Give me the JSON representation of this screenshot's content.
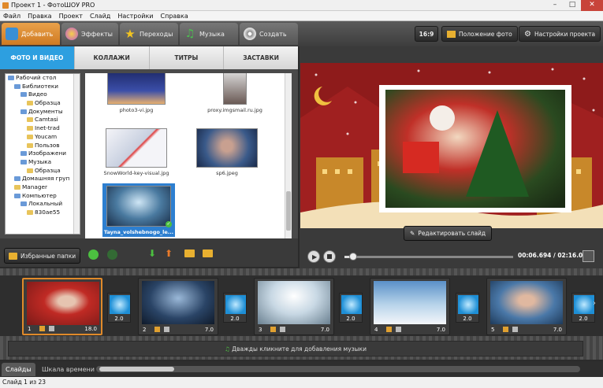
{
  "window": {
    "title": "Проект 1 - ФотоШОУ PRO"
  },
  "menu": [
    "Файл",
    "Правка",
    "Проект",
    "Слайд",
    "Настройки",
    "Справка"
  ],
  "tabs": [
    {
      "label": "Добавить",
      "color": "#3a8fd6"
    },
    {
      "label": "Эффекты",
      "color": "#c05ad0"
    },
    {
      "label": "Переходы",
      "color": "#e8c020"
    },
    {
      "label": "Музыка",
      "color": "#48b050"
    },
    {
      "label": "Создать",
      "color": "#d8d8d8"
    }
  ],
  "toolbar_right": {
    "ratio": "16:9",
    "photo_pos": "Положение фото",
    "project_settings": "Настройки проекта"
  },
  "subtabs": [
    "ФОТО И ВИДЕО",
    "КОЛЛАЖИ",
    "ТИТРЫ",
    "ЗАСТАВКИ"
  ],
  "tree": [
    {
      "label": "Рабочий стол",
      "indent": 0,
      "icon": "blue"
    },
    {
      "label": "Библиотеки",
      "indent": 1,
      "icon": "blue"
    },
    {
      "label": "Видео",
      "indent": 2,
      "icon": "blue"
    },
    {
      "label": "Образца",
      "indent": 3,
      "icon": "yellow"
    },
    {
      "label": "Документы",
      "indent": 2,
      "icon": "blue"
    },
    {
      "label": "Camtasi",
      "indent": 3,
      "icon": "yellow"
    },
    {
      "label": "Inet-trad",
      "indent": 3,
      "icon": "yellow"
    },
    {
      "label": "Youcam",
      "indent": 3,
      "icon": "yellow"
    },
    {
      "label": "Пользов",
      "indent": 3,
      "icon": "yellow"
    },
    {
      "label": "Изображени",
      "indent": 2,
      "icon": "blue"
    },
    {
      "label": "Музыка",
      "indent": 2,
      "icon": "blue"
    },
    {
      "label": "Образца",
      "indent": 3,
      "icon": "yellow"
    },
    {
      "label": "Домашняя груп",
      "indent": 1,
      "icon": "blue"
    },
    {
      "label": "Manager",
      "indent": 1,
      "icon": "yellow"
    },
    {
      "label": "Компьютер",
      "indent": 1,
      "icon": "blue"
    },
    {
      "label": "Локальный",
      "indent": 2,
      "icon": "blue"
    },
    {
      "label": "830ae55",
      "indent": 3,
      "icon": "yellow"
    }
  ],
  "thumbs": [
    {
      "name": "photo3-vi.jpg",
      "selected": false
    },
    {
      "name": "proxy.imgsmail.ru.jpg",
      "selected": false
    },
    {
      "name": "SnowWorld-key-visual.jpg",
      "selected": false
    },
    {
      "name": "sp6.jpeg",
      "selected": false
    },
    {
      "name": "Tayna_volshebnogo_le...",
      "selected": true
    }
  ],
  "left_bottom": {
    "favorites": "Избранные папки"
  },
  "preview": {
    "edit_slide": "Редактировать слайд"
  },
  "player": {
    "time": "00:06.694 / 02:16.000",
    "progress": 0.05
  },
  "slides": [
    {
      "num": "1",
      "dur": "18.0"
    },
    {
      "num": "2",
      "dur": "7.0"
    },
    {
      "num": "3",
      "dur": "7.0"
    },
    {
      "num": "4",
      "dur": "7.0"
    },
    {
      "num": "5",
      "dur": "7.0"
    }
  ],
  "transitions": [
    "2.0",
    "2.0",
    "2.0",
    "2.0",
    "2.0"
  ],
  "music_hint": "Дважды кликните для добавления музыки",
  "bottom_tabs": {
    "slides": "Слайды",
    "timeline": "Шкала времени"
  },
  "status": "Слайд 1 из 23"
}
